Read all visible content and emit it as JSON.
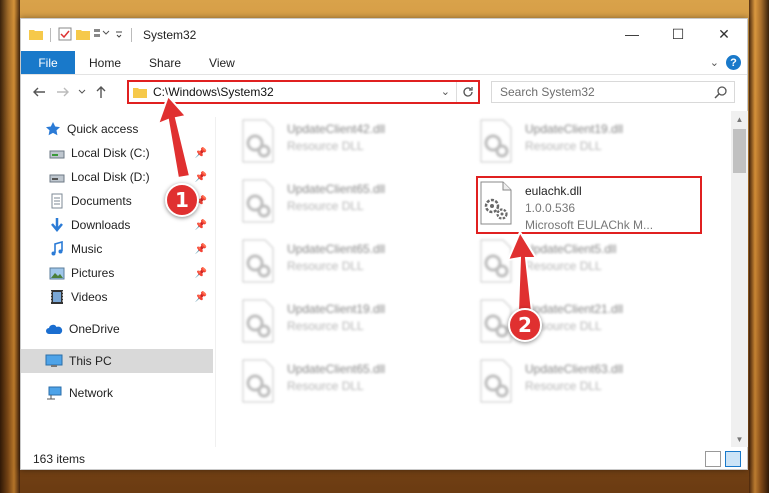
{
  "window": {
    "title": "System32",
    "controls": {
      "minimize": "—",
      "maximize": "☐",
      "close": "✕"
    }
  },
  "ribbon": {
    "tabs": [
      {
        "label": "File"
      },
      {
        "label": "Home"
      },
      {
        "label": "Share"
      },
      {
        "label": "View"
      }
    ],
    "help_label": "?"
  },
  "address": {
    "path": "C:\\Windows\\System32",
    "search_placeholder": "Search System32"
  },
  "nav": {
    "items": [
      {
        "label": "Quick access",
        "icon": "star-icon",
        "pinned": false
      },
      {
        "label": "Local Disk (C:)",
        "icon": "drive-icon",
        "pinned": true
      },
      {
        "label": "Local Disk (D:)",
        "icon": "drive-icon",
        "pinned": true
      },
      {
        "label": "Documents",
        "icon": "documents-icon",
        "pinned": true
      },
      {
        "label": "Downloads",
        "icon": "download-icon",
        "pinned": true
      },
      {
        "label": "Music",
        "icon": "music-icon",
        "pinned": true
      },
      {
        "label": "Pictures",
        "icon": "pictures-icon",
        "pinned": true
      },
      {
        "label": "Videos",
        "icon": "videos-icon",
        "pinned": true
      },
      {
        "label": "OneDrive",
        "icon": "cloud-icon",
        "pinned": false
      },
      {
        "label": "This PC",
        "icon": "computer-icon",
        "pinned": false,
        "selected": true
      },
      {
        "label": "Network",
        "icon": "network-icon",
        "pinned": false
      }
    ]
  },
  "files": {
    "left_column": [
      {
        "name": "UpdateClient42.dll",
        "desc": "Resource DLL"
      },
      {
        "name": "UpdateClient65.dll",
        "desc": "Resource DLL"
      },
      {
        "name": "UpdateClient65.dll",
        "desc": "Resource DLL"
      },
      {
        "name": "UpdateClient19.dll",
        "desc": "Resource DLL"
      },
      {
        "name": "UpdateClient65.dll",
        "desc": "Resource DLL"
      }
    ],
    "right_column": [
      {
        "name": "UpdateClient19.dll",
        "desc": "Resource DLL"
      },
      {
        "name": "eulachk.dll",
        "desc": "1.0.0.536",
        "desc2": "Microsoft EULAChk M...",
        "highlighted": true
      },
      {
        "name": "UpdateClient5.dll",
        "desc": "Resource DLL"
      },
      {
        "name": "UpdateClient21.dll",
        "desc": "Resource DLL"
      },
      {
        "name": "UpdateClient63.dll",
        "desc": "Resource DLL"
      }
    ]
  },
  "status": {
    "item_count": "163 items"
  },
  "annotations": {
    "step1": "1",
    "step2": "2",
    "color": "#e03030"
  }
}
